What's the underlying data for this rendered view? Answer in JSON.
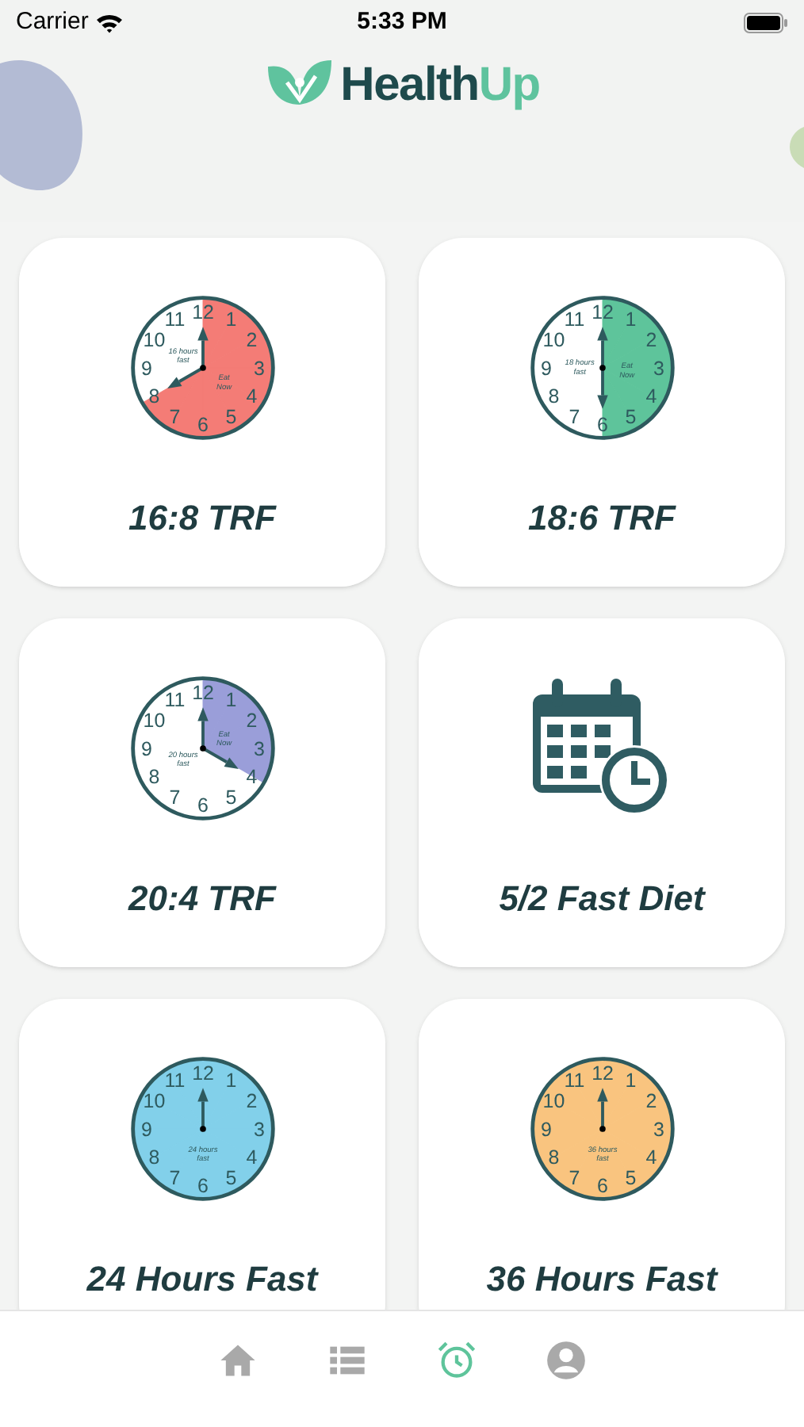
{
  "status_bar": {
    "carrier": "Carrier",
    "time": "5:33 PM"
  },
  "logo": {
    "parts": [
      "Health",
      "Up"
    ]
  },
  "plans": [
    {
      "kind": "clock",
      "title": "16:8 TRF",
      "color": "#f47c76",
      "fast_label": "16 hours fast",
      "eat_label": "Eat Now",
      "numerals": [
        {
          "text": "11",
          "eat": false
        },
        {
          "text": "12",
          "eat": true
        },
        {
          "text": "1",
          "eat": true
        },
        {
          "text": "10",
          "eat": false
        },
        {
          "text": "2",
          "eat": true
        },
        {
          "text": "9",
          "eat": false
        },
        {
          "text": "3",
          "eat": true
        },
        {
          "text": "8",
          "eat": false
        },
        {
          "text": "4",
          "eat": true
        },
        {
          "text": "7",
          "eat": true
        },
        {
          "text": "6",
          "eat": true
        },
        {
          "text": "5",
          "eat": true
        }
      ]
    },
    {
      "kind": "clock",
      "title": "18:6 TRF",
      "color": "#5ec49b",
      "fast_label": "18 hours fast",
      "eat_label": "Eat Now",
      "numerals": [
        {
          "text": "11",
          "eat": false
        },
        {
          "text": "12",
          "eat": true
        },
        {
          "text": "1",
          "eat": true
        },
        {
          "text": "10",
          "eat": false
        },
        {
          "text": "2",
          "eat": true
        },
        {
          "text": "9",
          "eat": false
        },
        {
          "text": "3",
          "eat": true
        },
        {
          "text": "8",
          "eat": false
        },
        {
          "text": "4",
          "eat": true
        },
        {
          "text": "7",
          "eat": false
        },
        {
          "text": "6",
          "eat": false
        },
        {
          "text": "5",
          "eat": true
        }
      ]
    },
    {
      "kind": "clock",
      "title": "20:4 TRF",
      "color": "#9a9ed9",
      "fast_label": "20 hours fast",
      "eat_label": "Eat Now",
      "numerals": [
        {
          "text": "11",
          "eat": false
        },
        {
          "text": "12",
          "eat": true
        },
        {
          "text": "1",
          "eat": true
        },
        {
          "text": "10",
          "eat": false
        },
        {
          "text": "2",
          "eat": true
        },
        {
          "text": "9",
          "eat": false
        },
        {
          "text": "3",
          "eat": true
        },
        {
          "text": "8",
          "eat": false
        },
        {
          "text": "4",
          "eat": false
        },
        {
          "text": "7",
          "eat": false
        },
        {
          "text": "6",
          "eat": false
        },
        {
          "text": "5",
          "eat": false
        }
      ]
    },
    {
      "kind": "calendar",
      "title": "5/2 Fast Diet"
    },
    {
      "kind": "clock",
      "title": "24 Hours Fast",
      "color": "#82d0ea",
      "fast_label": "24 hours fast",
      "numerals": [
        {
          "text": "11",
          "eat": true
        },
        {
          "text": "12",
          "eat": true
        },
        {
          "text": "1",
          "eat": true
        },
        {
          "text": "10",
          "eat": true
        },
        {
          "text": "2",
          "eat": true
        },
        {
          "text": "9",
          "eat": true
        },
        {
          "text": "3",
          "eat": true
        },
        {
          "text": "8",
          "eat": true
        },
        {
          "text": "4",
          "eat": true
        },
        {
          "text": "7",
          "eat": true
        },
        {
          "text": "6",
          "eat": true
        },
        {
          "text": "5",
          "eat": true
        }
      ]
    },
    {
      "kind": "clock",
      "title": "36 Hours Fast",
      "color": "#f9c47f",
      "fast_label": "36 hours fast",
      "numerals": [
        {
          "text": "11",
          "eat": true
        },
        {
          "text": "12",
          "eat": true
        },
        {
          "text": "1",
          "eat": true
        },
        {
          "text": "10",
          "eat": true
        },
        {
          "text": "2",
          "eat": true
        },
        {
          "text": "9",
          "eat": true
        },
        {
          "text": "3",
          "eat": true
        },
        {
          "text": "8",
          "eat": true
        },
        {
          "text": "4",
          "eat": true
        },
        {
          "text": "7",
          "eat": true
        },
        {
          "text": "6",
          "eat": true
        },
        {
          "text": "5",
          "eat": true
        }
      ]
    }
  ],
  "tabs": [
    {
      "kind": "home",
      "selected": false
    },
    {
      "kind": "list",
      "selected": false
    },
    {
      "kind": "alarm",
      "selected": true
    },
    {
      "kind": "profile",
      "selected": false
    }
  ]
}
